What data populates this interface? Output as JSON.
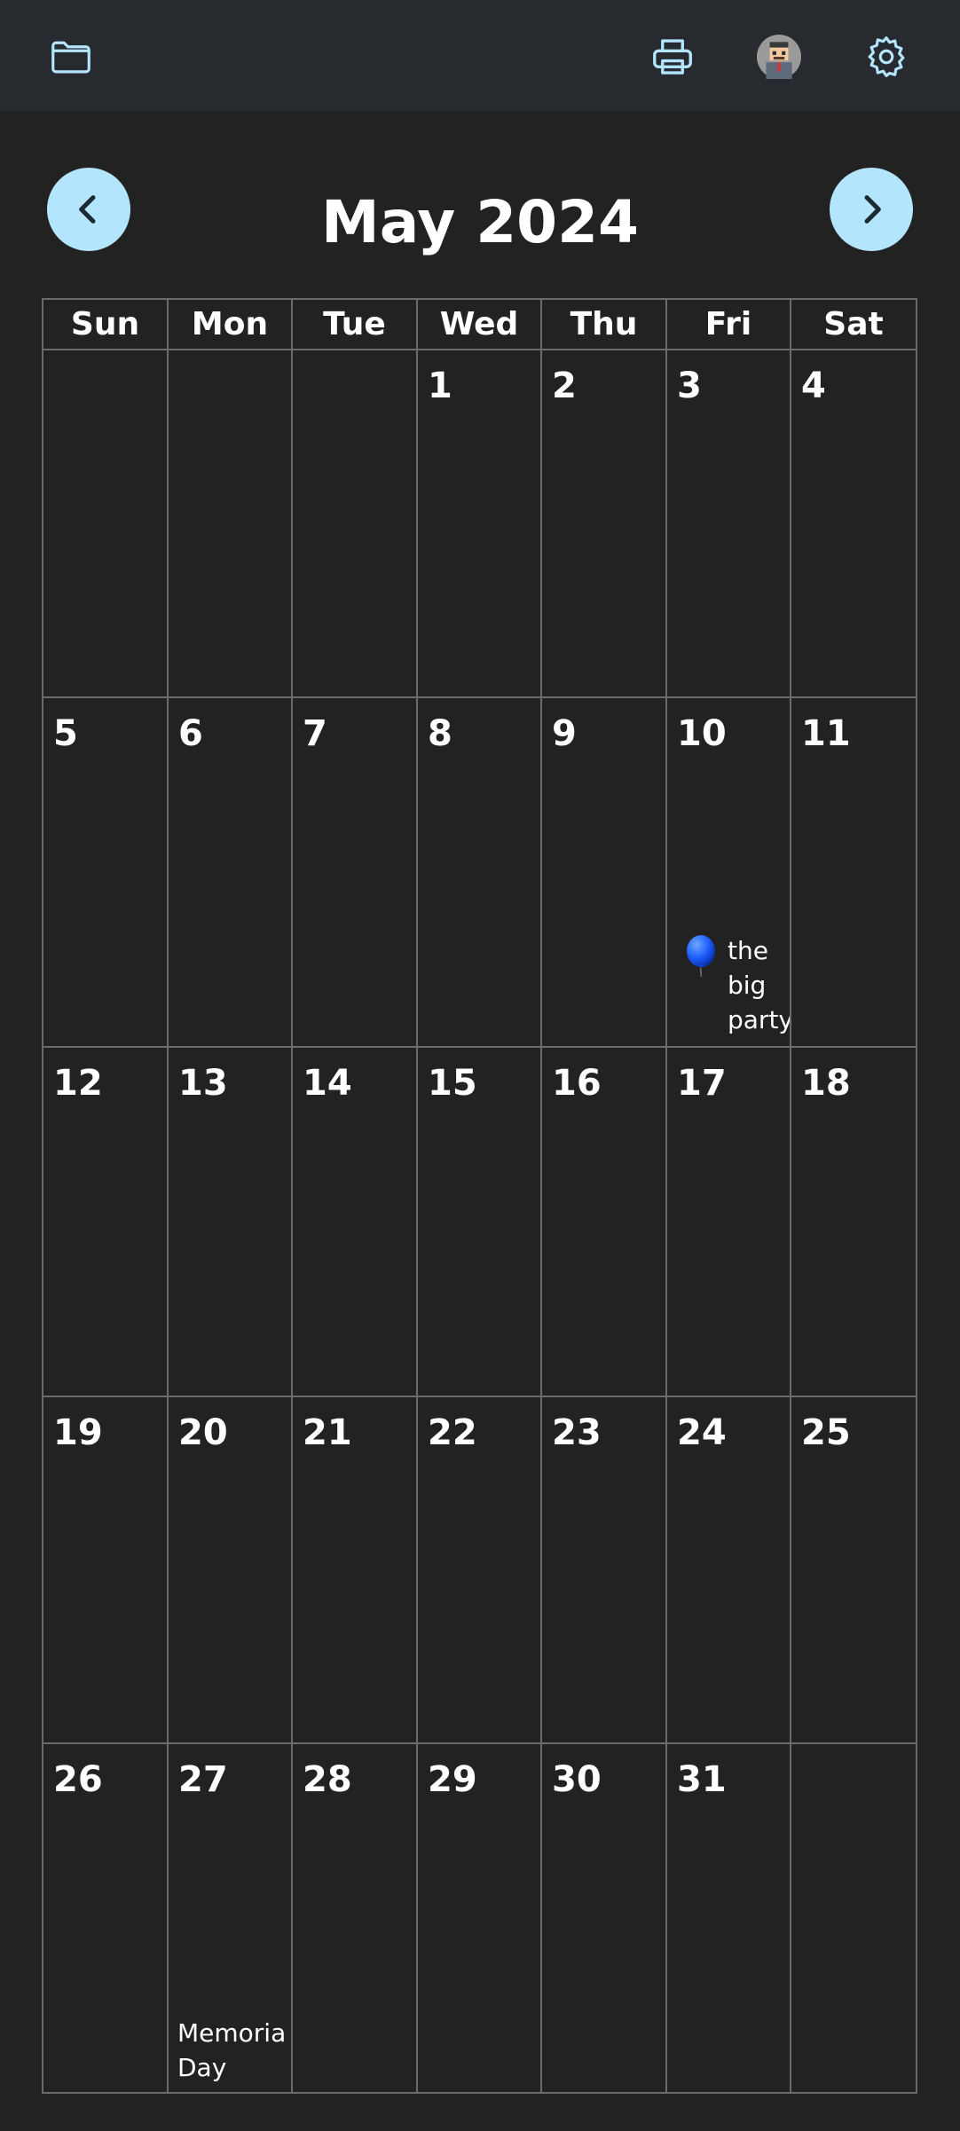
{
  "topbar": {
    "icons": {
      "folder": "folder-icon",
      "print": "printer-icon",
      "avatar": "avatar",
      "settings": "gear-icon"
    },
    "accent_color": "#b3e5fc"
  },
  "calendar": {
    "title": "May 2024",
    "weekdays": [
      "Sun",
      "Mon",
      "Tue",
      "Wed",
      "Thu",
      "Fri",
      "Sat"
    ],
    "weeks": [
      [
        "",
        "",
        "",
        "1",
        "2",
        "3",
        "4"
      ],
      [
        "5",
        "6",
        "7",
        "8",
        "9",
        "10",
        "11"
      ],
      [
        "12",
        "13",
        "14",
        "15",
        "16",
        "17",
        "18"
      ],
      [
        "19",
        "20",
        "21",
        "22",
        "23",
        "24",
        "25"
      ],
      [
        "26",
        "27",
        "28",
        "29",
        "30",
        "31",
        ""
      ]
    ],
    "events": [
      {
        "date": "10",
        "icon": "balloon-icon",
        "title": "the\nbig\nparty"
      }
    ],
    "holidays": [
      {
        "date": "27",
        "title": "Memoria\nDay"
      }
    ]
  }
}
